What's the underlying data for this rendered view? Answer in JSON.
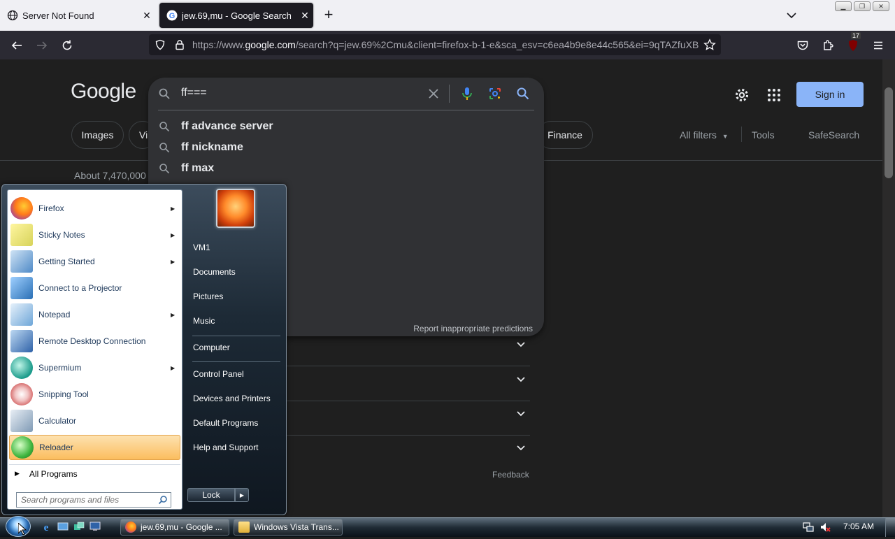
{
  "browser": {
    "tabs": [
      {
        "title": "Server Not Found",
        "active": false
      },
      {
        "title": "jew.69,mu - Google Search",
        "active": true
      }
    ],
    "url_prefix": "https://www.",
    "url_domain": "google.com",
    "url_rest": "/search?q=jew.69%2Cmu&client=firefox-b-1-e&sca_esv=c6ea4b9e8e44c565&ei=9qTAZfuXB",
    "extension_badge": "17"
  },
  "google": {
    "logo": "Google",
    "search_value": "ff===",
    "suggestions": [
      "ff advance server",
      "ff nickname",
      "ff max"
    ],
    "report_link": "Report inappropriate predictions",
    "chips": [
      "Images",
      "Vi",
      "Finance"
    ],
    "filters": [
      "All filters",
      "Tools",
      "SafeSearch"
    ],
    "result_stats": "About 7,470,000",
    "sign_in": "Sign in",
    "feedback": "Feedback"
  },
  "start_menu": {
    "programs": [
      {
        "label": "Firefox",
        "arrow": true,
        "color": "#e66000"
      },
      {
        "label": "Sticky Notes",
        "arrow": true,
        "color": "#d7d35a"
      },
      {
        "label": "Getting Started",
        "arrow": true,
        "color": "#4f8ac7"
      },
      {
        "label": "Connect to a Projector",
        "arrow": false,
        "color": "#2a6fb5"
      },
      {
        "label": "Notepad",
        "arrow": true,
        "color": "#6ea6d8"
      },
      {
        "label": "Remote Desktop Connection",
        "arrow": false,
        "color": "#2f62a8"
      },
      {
        "label": "Supermium",
        "arrow": true,
        "color": "#1a9a8a"
      },
      {
        "label": "Snipping Tool",
        "arrow": false,
        "color": "#c94040"
      },
      {
        "label": "Calculator",
        "arrow": false,
        "color": "#7f9ab5"
      },
      {
        "label": "Reloader",
        "arrow": false,
        "color": "#3fb53f"
      }
    ],
    "all_programs": "All Programs",
    "search_placeholder": "Search programs and files",
    "right_links": [
      "VM1",
      "Documents",
      "Pictures",
      "Music",
      "Computer",
      "Control Panel",
      "Devices and Printers",
      "Default Programs",
      "Help and Support"
    ],
    "lock": "Lock"
  },
  "taskbar": {
    "buttons": [
      "jew.69,mu - Google ...",
      "Windows Vista Trans..."
    ],
    "clock": "7:05 AM"
  }
}
